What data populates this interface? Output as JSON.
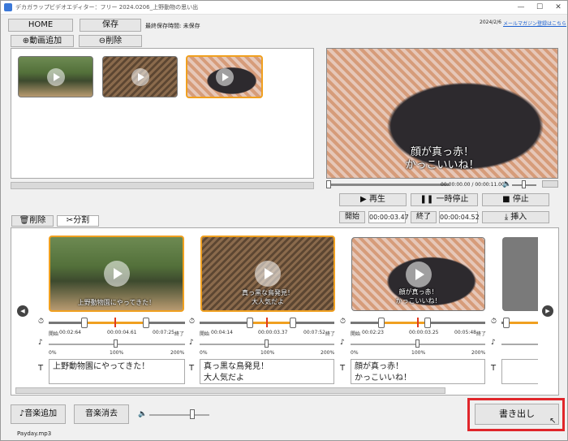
{
  "window": {
    "title": "デカガラップビデオエディター：フリー  2024.0206_上野動物の思い出",
    "minimize": "—",
    "maximize": "☐",
    "close": "✕"
  },
  "toolbar": {
    "home": "HOME",
    "save": "保存",
    "last_saved": "最終保存時間: 未保存",
    "top_link_date": "2024/2/6",
    "top_link": "メールマガジン登録はこちら"
  },
  "media_tabs": {
    "add": "動画追加",
    "delete": "削除"
  },
  "preview": {
    "caption_line1": "顔が真っ赤！",
    "caption_line2": "かっこいいね！",
    "time": "00:00:00.00 / 00:00:11.00"
  },
  "controls": {
    "play": "再生",
    "pause": "一時停止",
    "stop": "停止",
    "start_label": "開始",
    "start_time": "00:00:03.47",
    "end_label": "終了",
    "end_time": "00:00:04.52",
    "insert": "挿入"
  },
  "edit_tabs": {
    "delete": "削除",
    "split": "分割"
  },
  "clips": [
    {
      "caption1": "上野動物園にやってきた！",
      "caption2": "",
      "t_start_label": "開始",
      "t_start": "00:02:64",
      "t_mid": "00:00:04.61",
      "t_end": "00:07:25",
      "t_end_label": "終了",
      "vol_min": "0%",
      "vol_mid": "100%",
      "vol_max": "200%",
      "text": "上野動物園にやってきた！"
    },
    {
      "caption1": "真っ黒な鳥発見！",
      "caption2": "大人気だよ",
      "t_start_label": "開始",
      "t_start": "00:04:14",
      "t_mid": "00:00:03.37",
      "t_end": "00:07:52",
      "t_end_label": "終了",
      "vol_min": "0%",
      "vol_mid": "100%",
      "vol_max": "200%",
      "text": "真っ黒な鳥発見！\n大人気だよ"
    },
    {
      "caption1": "顔が真っ赤！",
      "caption2": "かっこいいね！",
      "t_start_label": "開始",
      "t_start": "00:02:23",
      "t_mid": "00:00:03.25",
      "t_end": "00:05:48",
      "t_end_label": "終了",
      "vol_min": "0%",
      "vol_mid": "100%",
      "vol_max": "200%",
      "text": "顔が真っ赤！\nかっこいいね！"
    }
  ],
  "bottom": {
    "add_music": "音楽追加",
    "remove_music": "音楽消去",
    "music_file": "Payday.mp3",
    "export": "書き出し"
  },
  "icons": {
    "play": "play-icon",
    "pause": "pause-icon",
    "stop": "stop-icon",
    "insert": "download-icon"
  },
  "colors": {
    "accent": "#f0a020",
    "highlight": "#e0262b",
    "marker": "#e03a1e"
  }
}
